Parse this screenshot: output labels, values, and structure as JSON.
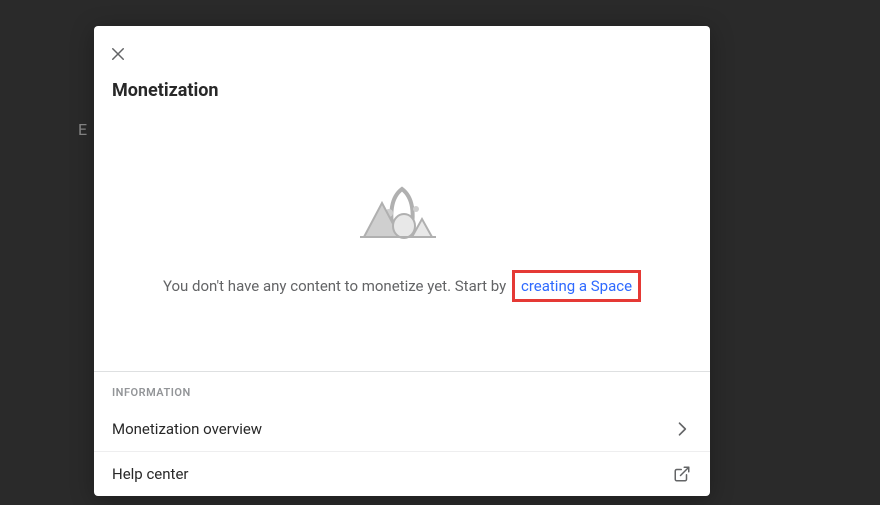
{
  "modal": {
    "title": "Monetization",
    "empty_state": {
      "prefix_text": "You don't have any content to monetize yet. Start by",
      "link_text": "creating a Space"
    }
  },
  "info": {
    "header": "INFORMATION",
    "rows": [
      {
        "label": "Monetization overview",
        "icon": "chevron"
      },
      {
        "label": "Help center",
        "icon": "external"
      }
    ]
  },
  "backdrop": {
    "partial_text": "E"
  }
}
